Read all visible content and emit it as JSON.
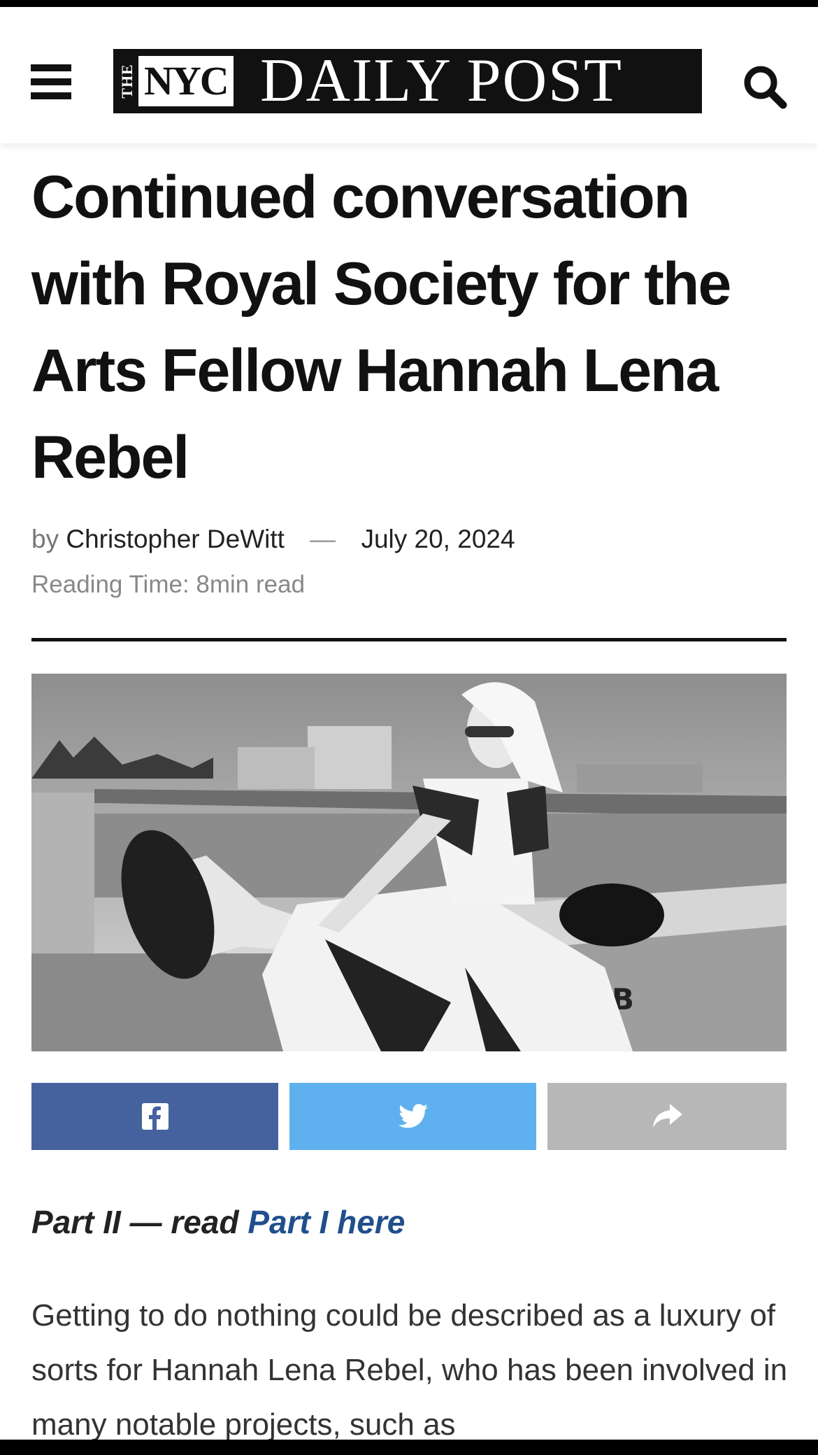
{
  "header": {
    "logo_the": "THE",
    "logo_nyc": "NYC",
    "logo_main": "DAILY POST",
    "menu_icon": "hamburger-menu-icon",
    "search_icon": "search-icon"
  },
  "article": {
    "title": "Continued conversation with Royal Society for the Arts Fellow Hannah Lena Rebel",
    "by_label": "by",
    "author": "Christopher DeWitt",
    "separator": "—",
    "date": "July 20, 2024",
    "reading_time": "Reading Time: 8min read",
    "part_prefix": "Part II — read ",
    "part_link": "Part I here",
    "body": "Getting to do nothing could be described as a luxury of sorts for Hannah Lena Rebel, who has been involved in many notable projects, such as"
  },
  "share": {
    "facebook_icon": "facebook-icon",
    "twitter_icon": "twitter-icon",
    "share_icon": "share-arrow-icon",
    "colors": {
      "facebook": "#45629f",
      "twitter": "#5eb1ee",
      "more": "#b7b7b7"
    }
  },
  "colors": {
    "link": "#204f8c",
    "text": "#111111",
    "meta": "#888888"
  }
}
